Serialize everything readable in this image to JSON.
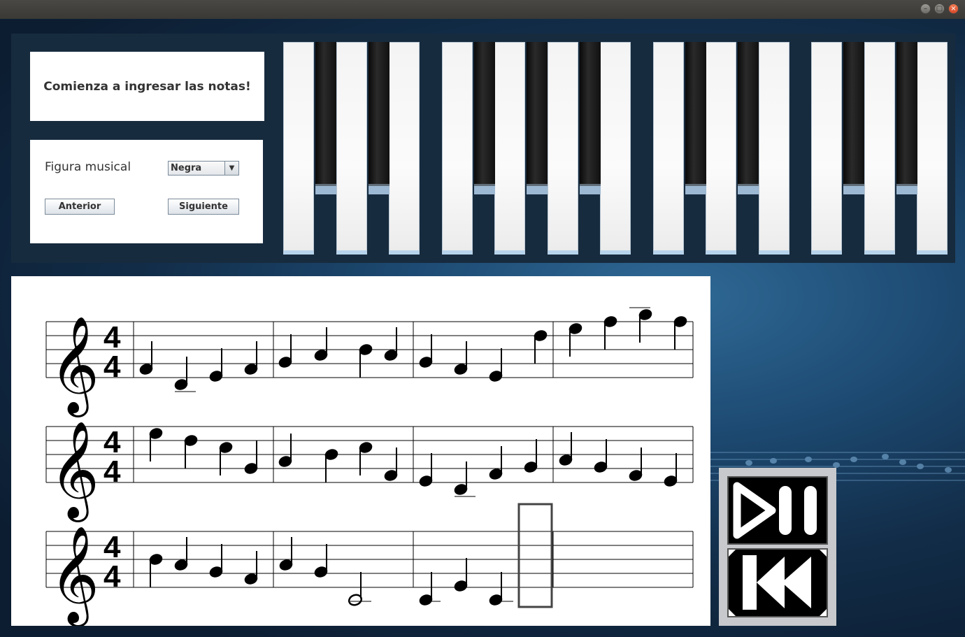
{
  "window": {
    "controls": [
      "minimize-icon",
      "maximize-icon",
      "close-icon"
    ]
  },
  "message": {
    "text": "Comienza a ingresar las notas!"
  },
  "figure_panel": {
    "label": "Figura musical",
    "select_value": "Negra",
    "prev_button": "Anterior",
    "next_button": "Siguiente"
  },
  "piano": {
    "white_keys": 13,
    "black_keys": 9
  },
  "score": {
    "clef": "treble-clef",
    "time_signature": {
      "top": "4",
      "bottom": "4"
    },
    "staves": 3,
    "measures_per_staff": 4
  },
  "transport": {
    "play_pause": "play-pause-icon",
    "rewind": "rewind-icon"
  },
  "colors": {
    "panel": "#172b3e",
    "background": "#1d4a72",
    "controls": "#c7c9cc"
  }
}
